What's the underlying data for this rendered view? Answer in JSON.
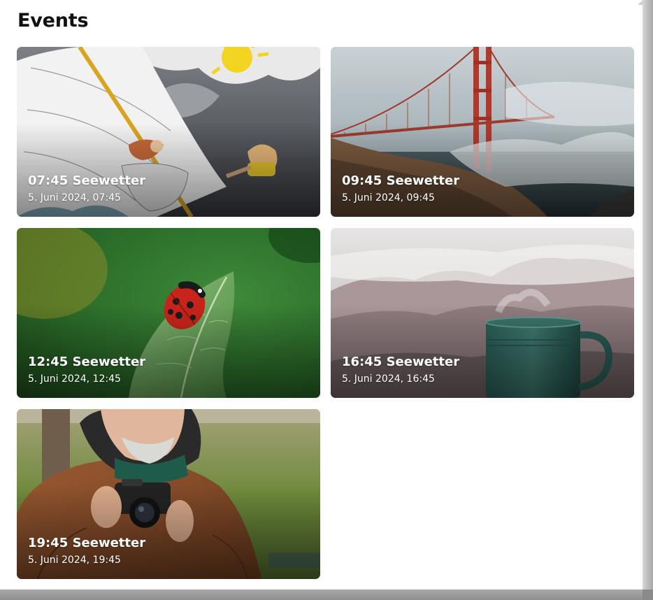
{
  "page": {
    "heading": "Events"
  },
  "events": [
    {
      "title": "07:45 Seewetter",
      "date": "5. Juni 2024, 07:45",
      "image": "sailing-cartoon-image"
    },
    {
      "title": "09:45 Seewetter",
      "date": "5. Juni 2024, 09:45",
      "image": "golden-gate-fog-image"
    },
    {
      "title": "12:45 Seewetter",
      "date": "5. Juni 2024, 12:45",
      "image": "ladybug-leaf-image"
    },
    {
      "title": "16:45 Seewetter",
      "date": "5. Juni 2024, 16:45",
      "image": "steaming-mug-image"
    },
    {
      "title": "19:45 Seewetter",
      "date": "5. Juni 2024, 19:45",
      "image": "photographer-image"
    }
  ]
}
